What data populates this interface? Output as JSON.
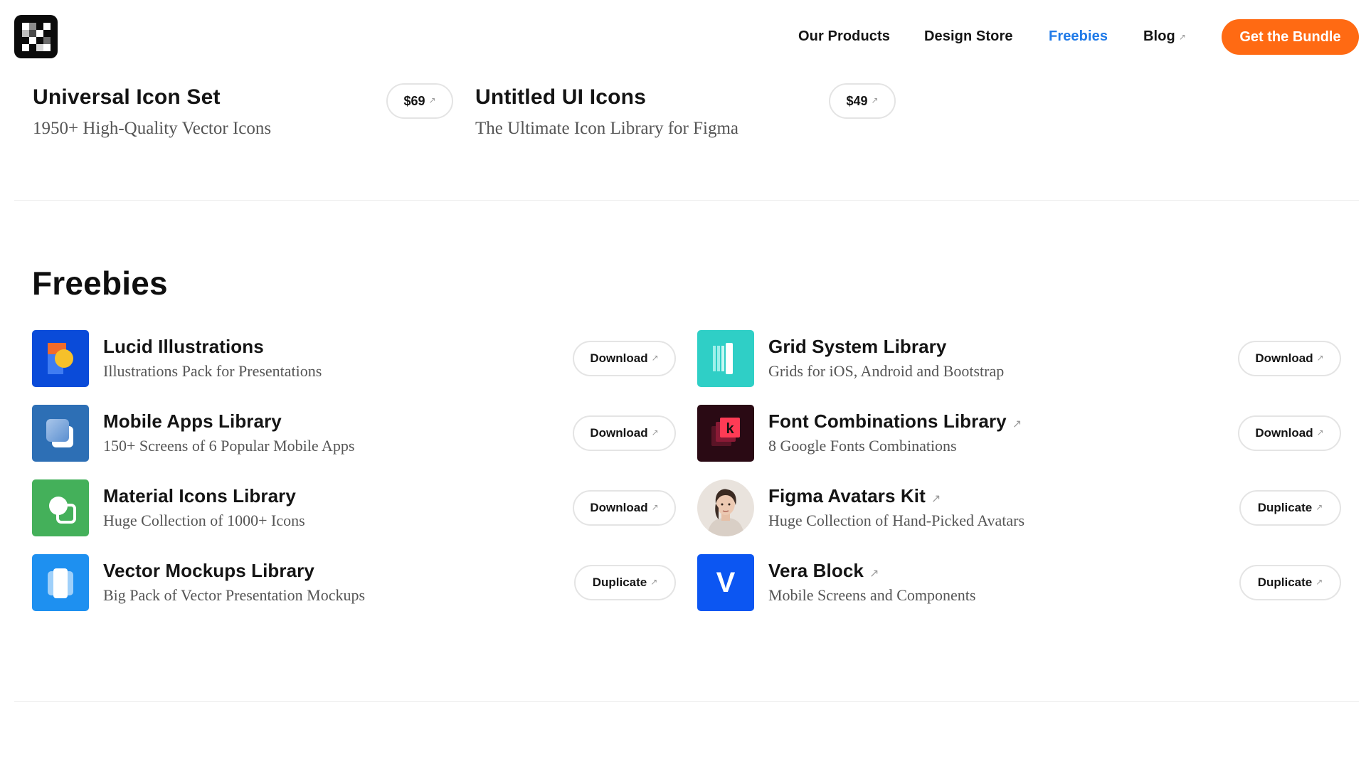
{
  "header": {
    "nav": [
      {
        "label": "Our Products",
        "active": false,
        "external": false
      },
      {
        "label": "Design Store",
        "active": false,
        "external": false
      },
      {
        "label": "Freebies",
        "active": true,
        "external": false
      },
      {
        "label": "Blog",
        "active": false,
        "external": true
      }
    ],
    "cta_label": "Get the Bundle",
    "external_glyph": "↗"
  },
  "products": [
    {
      "title": "Universal Icon Set",
      "subtitle": "1950+ High-Quality Vector Icons",
      "price": "$69"
    },
    {
      "title": "Untitled UI Icons",
      "subtitle": "The Ultimate Icon Library for Figma",
      "price": "$49"
    }
  ],
  "freebies": {
    "title": "Freebies",
    "left": [
      {
        "title": "Lucid Illustrations",
        "subtitle": "Illustrations Pack for Presentations",
        "action": "Download",
        "external_title": false,
        "icon": "lucid-illustrations-icon"
      },
      {
        "title": "Mobile Apps Library",
        "subtitle": "150+ Screens of 6 Popular Mobile Apps",
        "action": "Download",
        "external_title": false,
        "icon": "mobile-apps-icon"
      },
      {
        "title": "Material Icons Library",
        "subtitle": "Huge Collection of 1000+ Icons",
        "action": "Download",
        "external_title": false,
        "icon": "material-icons-icon"
      },
      {
        "title": "Vector Mockups Library",
        "subtitle": "Big Pack of Vector Presentation Mockups",
        "action": "Duplicate",
        "external_title": false,
        "icon": "vector-mockups-icon"
      }
    ],
    "right": [
      {
        "title": "Grid System Library",
        "subtitle": "Grids for iOS, Android and Bootstrap",
        "action": "Download",
        "external_title": false,
        "icon": "grid-system-icon"
      },
      {
        "title": "Font Combinations Library",
        "subtitle": "8 Google Fonts Combinations",
        "action": "Download",
        "external_title": true,
        "icon": "font-combinations-icon"
      },
      {
        "title": "Figma Avatars Kit",
        "subtitle": "Huge Collection of Hand-Picked Avatars",
        "action": "Duplicate",
        "external_title": true,
        "icon": "avatar-photo"
      },
      {
        "title": "Vera Block",
        "subtitle": "Mobile Screens and Components",
        "action": "Duplicate",
        "external_title": true,
        "icon": "vera-block-icon",
        "icon_letter": "V"
      }
    ]
  },
  "colors": {
    "accent": "#ff6a13",
    "active_link": "#1f7ae8",
    "lucid": "#0a4bd9",
    "mobile_apps": "#2d6fb5",
    "material": "#44b05a",
    "vector_mockups": "#1e90f0",
    "grid_system": "#2fcfc6",
    "font_combinations": "#2a0a14",
    "vera_block": "#0c56f2"
  },
  "font_icon_letter": "k"
}
